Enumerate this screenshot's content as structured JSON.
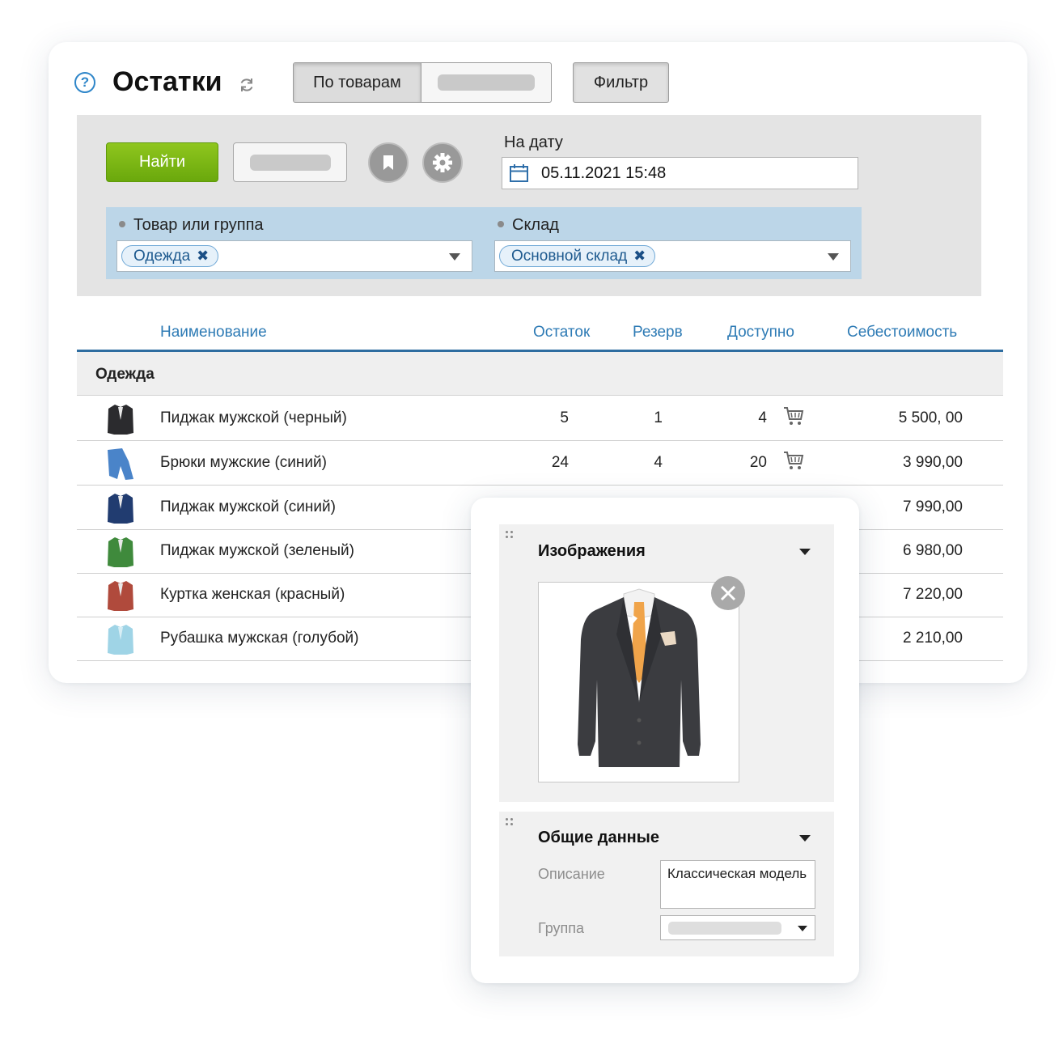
{
  "header": {
    "help_icon": "?",
    "title": "Остатки",
    "view_tabs": [
      {
        "label": "По товарам"
      },
      {
        "label": ""
      }
    ],
    "filter_label": "Фильтр"
  },
  "filter_panel": {
    "find_label": "Найти",
    "date_label": "На дату",
    "date_value": "05.11.2021 15:48",
    "conditions": {
      "product_label": "Товар или группа",
      "product_tag": "Одежда",
      "warehouse_label": "Склад",
      "warehouse_tag": "Основной склад"
    }
  },
  "table": {
    "columns": {
      "name": "Наименование",
      "stock": "Остаток",
      "reserve": "Резерв",
      "available": "Доступно",
      "cost": "Себестоимость"
    },
    "group_name": "Одежда",
    "rows": [
      {
        "name": "Пиджак мужской (черный)",
        "stock": "5",
        "reserve": "1",
        "available": "4",
        "cost": "5 500, 00",
        "color": "#2b2b2e"
      },
      {
        "name": "Брюки мужские (синий)",
        "stock": "24",
        "reserve": "4",
        "available": "20",
        "cost": "3 990,00",
        "color": "#4a84c9"
      },
      {
        "name": "Пиджак мужской (синий)",
        "stock": "",
        "reserve": "",
        "available": "",
        "cost": "7 990,00",
        "color": "#213c70"
      },
      {
        "name": "Пиджак мужской (зеленый)",
        "stock": "",
        "reserve": "",
        "available": "",
        "cost": "6 980,00",
        "color": "#3f8a3c"
      },
      {
        "name": "Куртка женская (красный)",
        "stock": "",
        "reserve": "",
        "available": "",
        "cost": "7 220,00",
        "color": "#b04a3c"
      },
      {
        "name": "Рубашка мужская (голубой)",
        "stock": "",
        "reserve": "",
        "available": "",
        "cost": "2 210,00",
        "color": "#9fd4e6"
      }
    ]
  },
  "popup": {
    "images_title": "Изображения",
    "general_title": "Общие данные",
    "description_label": "Описание",
    "description_value": "Классическая модель",
    "group_label": "Группа"
  },
  "colors": {
    "accent_blue": "#2e7bb5",
    "find_green": "#7ab515",
    "condition_bg": "#bcd6e8"
  }
}
